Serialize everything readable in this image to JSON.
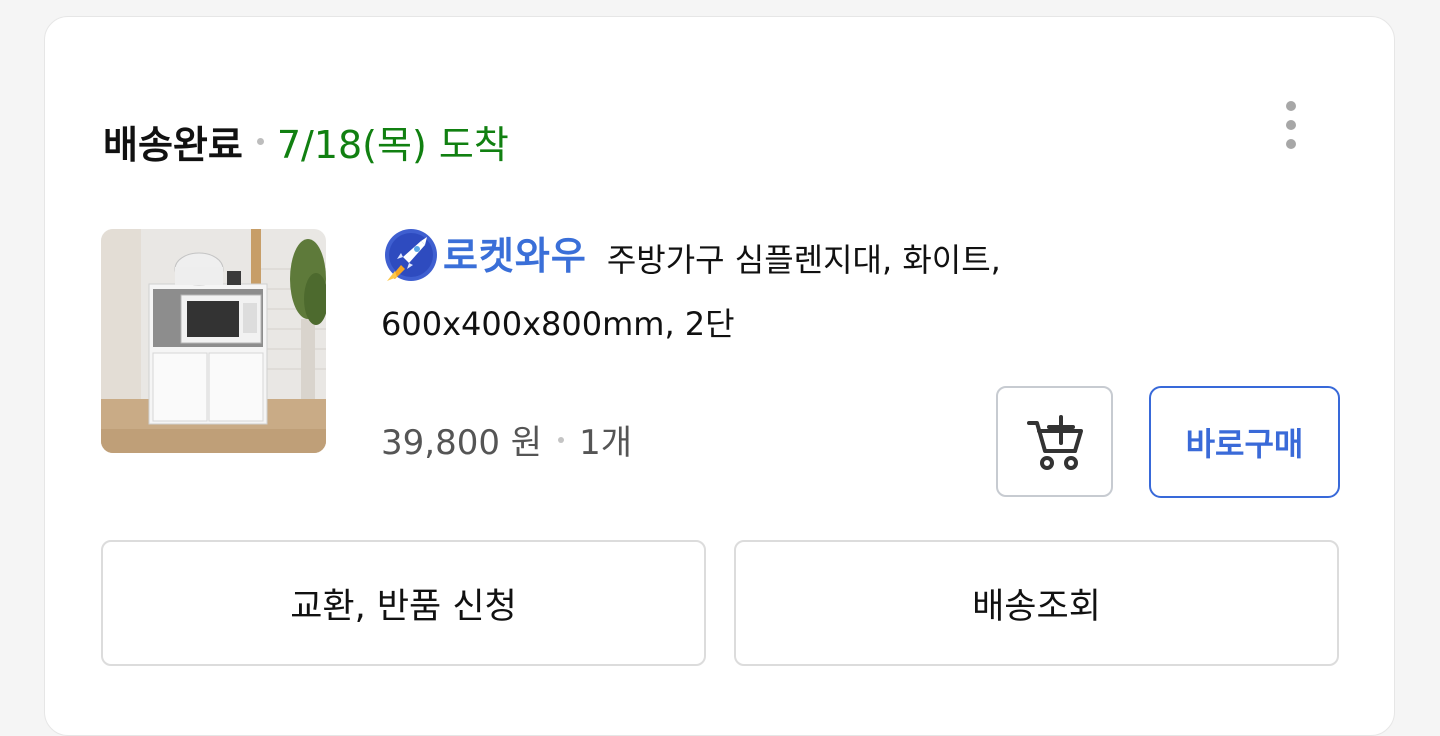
{
  "order": {
    "status": "배송완료",
    "arrival": "7/18(목) 도착",
    "more_icon": "more-vertical-icon"
  },
  "product": {
    "badge_text": "로켓와우",
    "badge_icon": "rocket-icon",
    "name": "주방가구 심플렌지대, 화이트, 600x400x800mm, 2단",
    "price": "39,800 원",
    "quantity": "1개",
    "image_alt": "white kitchen cabinet with microwave"
  },
  "buttons": {
    "cart_icon": "add-to-cart-icon",
    "buy_now": "바로구매",
    "exchange_return": "교환, 반품 신청",
    "track_delivery": "배송조회"
  },
  "colors": {
    "arrival_green": "#118011",
    "accent_blue": "#3a6ad8"
  }
}
